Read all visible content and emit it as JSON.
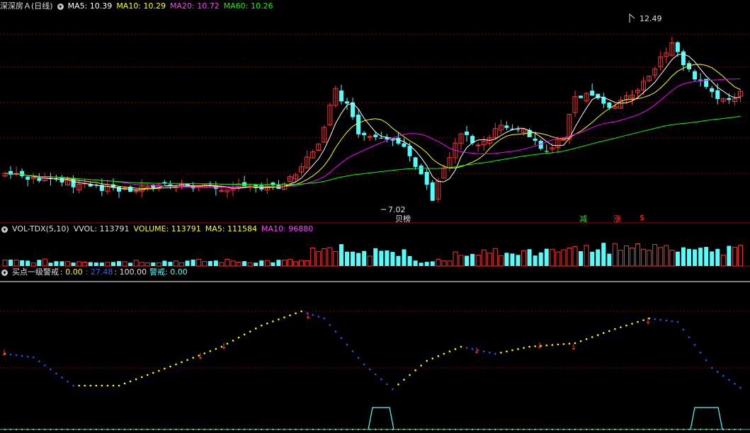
{
  "price_panel": {
    "title": "深深房Ａ(日线)",
    "ma5": "MA5: 10.39",
    "ma10": "MA10: 10.29",
    "ma20": "MA20: 10.72",
    "ma60": "MA60: 10.26",
    "high_label": "12.49",
    "low_label": "7.02",
    "signals": {
      "bangdan": "贝榜",
      "jian": "减",
      "zhang": "涨",
      "s": "$"
    }
  },
  "volume_panel": {
    "title": "VOL-TDX(5,10)",
    "vvol": "VVOL: 113791",
    "volume": "VOLUME: 113791",
    "ma5": "MA5: 111584",
    "ma10": "MA10: 96880"
  },
  "indicator_panel": {
    "title": "买点一级警戒",
    "v1": ": 0.00",
    "v2": ": 27.48",
    "v3": ": 100.00",
    "warn": "警戒: 0.00"
  },
  "colors": {
    "up": "#ff3232",
    "down": "#54fcfc",
    "ma5": "#ffffff",
    "ma10": "#ffff00",
    "ma20": "#ff00ff",
    "ma60": "#00ff00",
    "grid": "#8b0000"
  },
  "icons": [
    "panel-menu-icon"
  ]
}
